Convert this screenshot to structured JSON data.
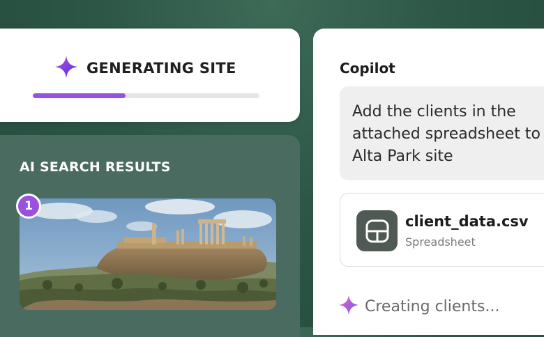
{
  "generating": {
    "title": "GENERATING SITE",
    "progress": 0.41,
    "accent_color": "#9b51e0",
    "icon": "sparkle-icon"
  },
  "search": {
    "title": "AI SEARCH RESULTS",
    "results": [
      {
        "rank": "1",
        "image": "acropolis-ruins-photo"
      }
    ]
  },
  "copilot": {
    "title": "Copilot",
    "message": "Add the clients in the\nattached spreadsheet to\nAlta Park site",
    "attachment": {
      "name": "client_data.csv",
      "type": "Spreadsheet",
      "icon": "spreadsheet-icon"
    },
    "status": "Creating clients...",
    "status_icon": "sparkle-icon"
  }
}
